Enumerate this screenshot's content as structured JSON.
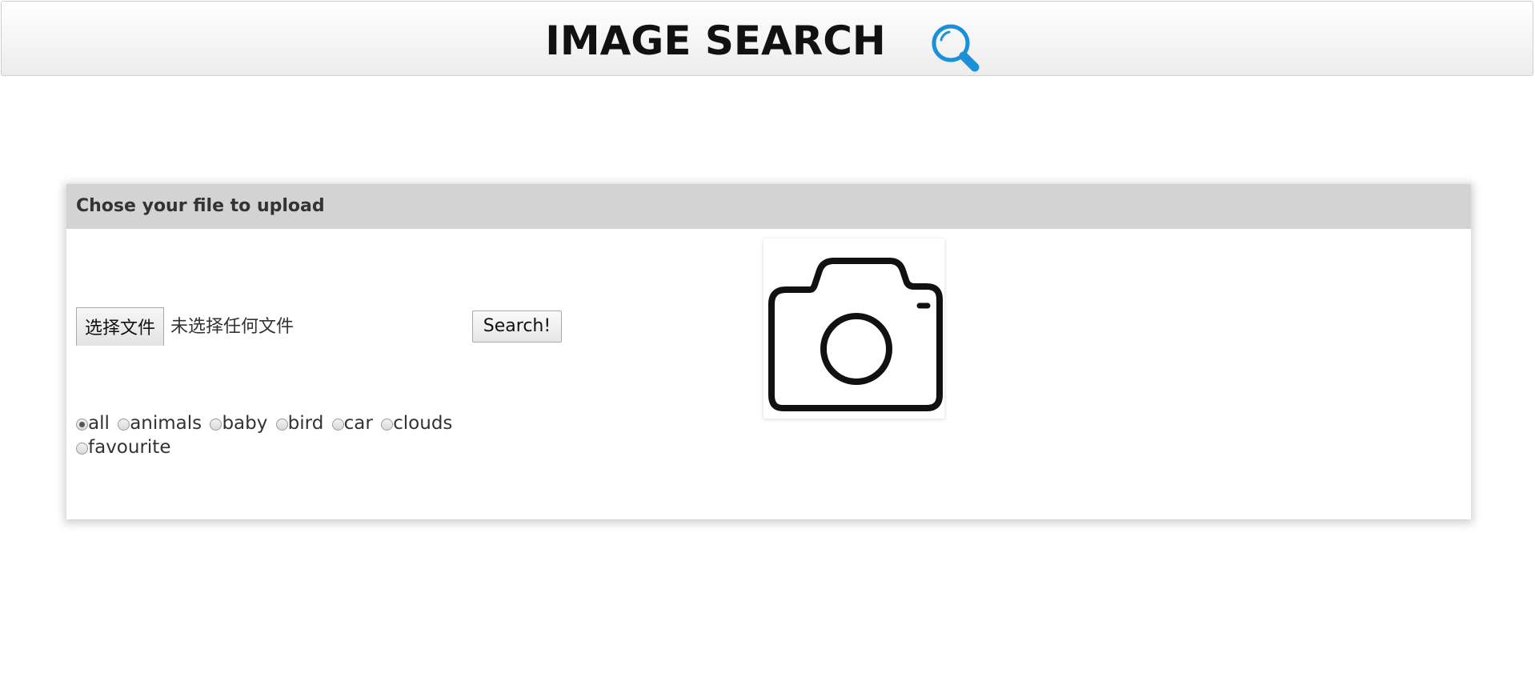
{
  "header": {
    "title": "IMAGE SEARCH",
    "icon": "magnifier-icon",
    "icon_color": "#1a90d8"
  },
  "upload_panel": {
    "heading": "Chose your file to upload",
    "file_button_label": "选择文件",
    "file_status": "未选择任何文件",
    "search_button_label": "Search!",
    "preview_icon": "camera-icon"
  },
  "categories": {
    "selected": "all",
    "options": [
      "all",
      "animals",
      "baby",
      "bird",
      "car",
      "clouds",
      "favourite"
    ]
  },
  "colors": {
    "panel_heading_bg": "#d3d3d3",
    "text": "#333333"
  }
}
